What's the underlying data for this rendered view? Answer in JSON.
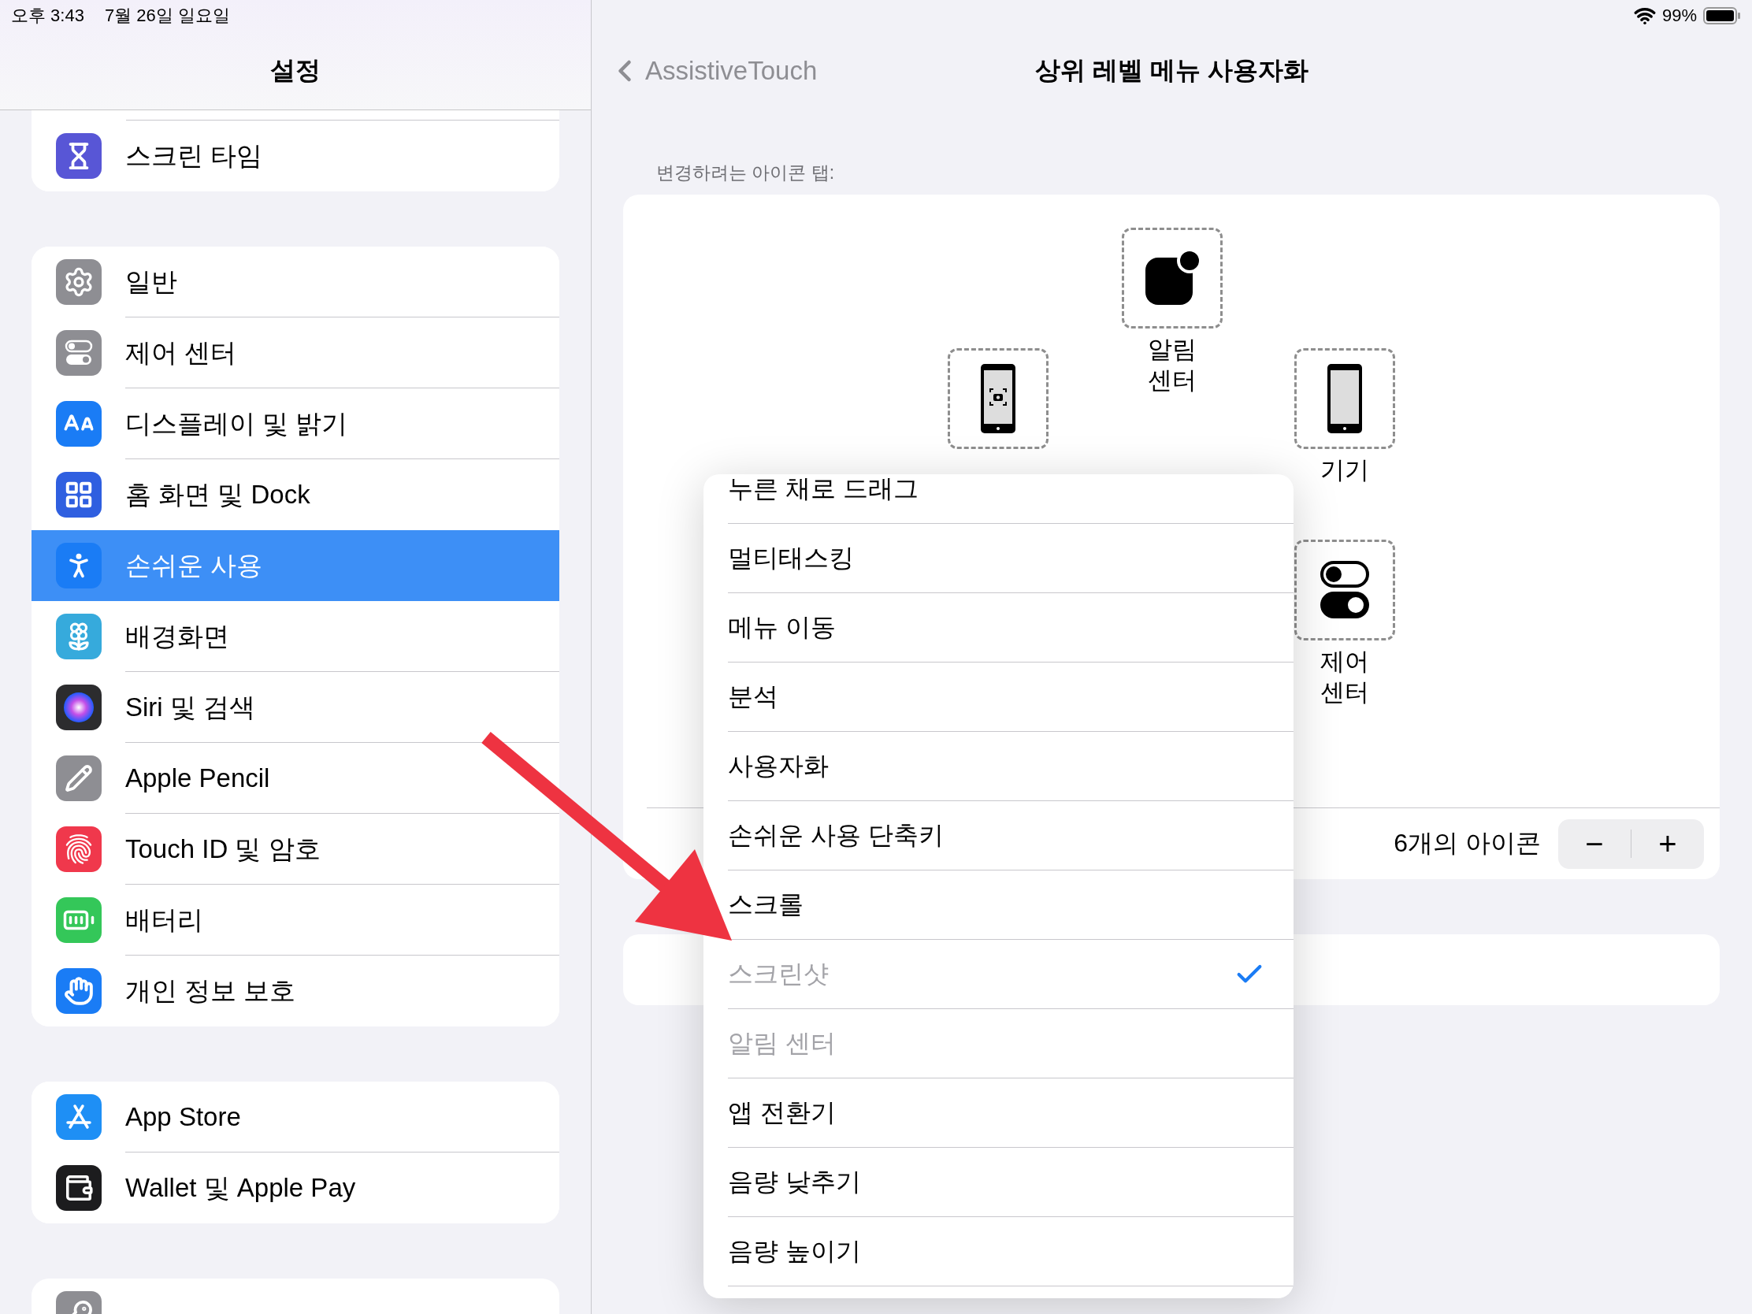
{
  "status_bar": {
    "time": "오후 3:43",
    "date": "7월 26일 일요일",
    "battery": "99%"
  },
  "sidebar": {
    "title": "설정",
    "groups": [
      {
        "items": [
          {
            "label": "스크린 타임",
            "selected": false,
            "color": "#5856d6"
          }
        ]
      },
      {
        "items": [
          {
            "label": "일반",
            "selected": false,
            "color": "#8e8e93"
          },
          {
            "label": "제어 센터",
            "selected": false,
            "color": "#8e8e93"
          },
          {
            "label": "디스플레이 및 밝기",
            "selected": false,
            "color": "#1a7cf5"
          },
          {
            "label": "홈 화면 및 Dock",
            "selected": false,
            "color": "#2f5fe0"
          },
          {
            "label": "손쉬운 사용",
            "selected": true,
            "color": "#1a7cf5"
          },
          {
            "label": "배경화면",
            "selected": false,
            "color": "#36aadc"
          },
          {
            "label": "Siri 및 검색",
            "selected": false,
            "color": "#2c2c2e"
          },
          {
            "label": "Apple Pencil",
            "selected": false,
            "color": "#8e8e93"
          },
          {
            "label": "Touch ID 및 암호",
            "selected": false,
            "color": "#f0384c"
          },
          {
            "label": "배터리",
            "selected": false,
            "color": "#34c759"
          },
          {
            "label": "개인 정보 보호",
            "selected": false,
            "color": "#1a7cf5"
          }
        ]
      },
      {
        "items": [
          {
            "label": "App Store",
            "selected": false,
            "color": "#1e8ff5"
          },
          {
            "label": "Wallet 및 Apple Pay",
            "selected": false,
            "color": "#1c1c1e"
          }
        ]
      },
      {
        "items": [
          {
            "selected": false,
            "color": "#8e8e93"
          }
        ]
      }
    ]
  },
  "detail": {
    "back": "AssistiveTouch",
    "title": "상위 레벨 메뉴 사용자화",
    "section_label": "변경하려는 아이콘 탭:",
    "tiles": [
      {
        "kind": "notification",
        "label": "알림 센터"
      },
      {
        "kind": "screenshot"
      },
      {
        "kind": "device",
        "label": "기기"
      },
      {
        "kind": "control",
        "label": "제어 센터"
      }
    ],
    "icon_count": "6개의 아이콘",
    "stepper": [
      "−",
      "+"
    ]
  },
  "popover": {
    "items": [
      {
        "label": "누른 채로 드래그",
        "checked": false,
        "disabled": false
      },
      {
        "label": "멀티태스킹",
        "checked": false,
        "disabled": false
      },
      {
        "label": "메뉴 이동",
        "checked": false,
        "disabled": false
      },
      {
        "label": "분석",
        "checked": false,
        "disabled": false
      },
      {
        "label": "사용자화",
        "checked": false,
        "disabled": false
      },
      {
        "label": "손쉬운 사용 단축키",
        "checked": false,
        "disabled": false
      },
      {
        "label": "스크롤",
        "checked": false,
        "disabled": false
      },
      {
        "label": "스크린샷",
        "checked": true,
        "disabled": true
      },
      {
        "label": "알림 센터",
        "checked": false,
        "disabled": true
      },
      {
        "label": "앱 전환기",
        "checked": false,
        "disabled": false
      },
      {
        "label": "음량 낮추기",
        "checked": false,
        "disabled": false
      },
      {
        "label": "음량 높이기",
        "checked": false,
        "disabled": false
      }
    ]
  },
  "annotation": {
    "kind": "arrow"
  }
}
